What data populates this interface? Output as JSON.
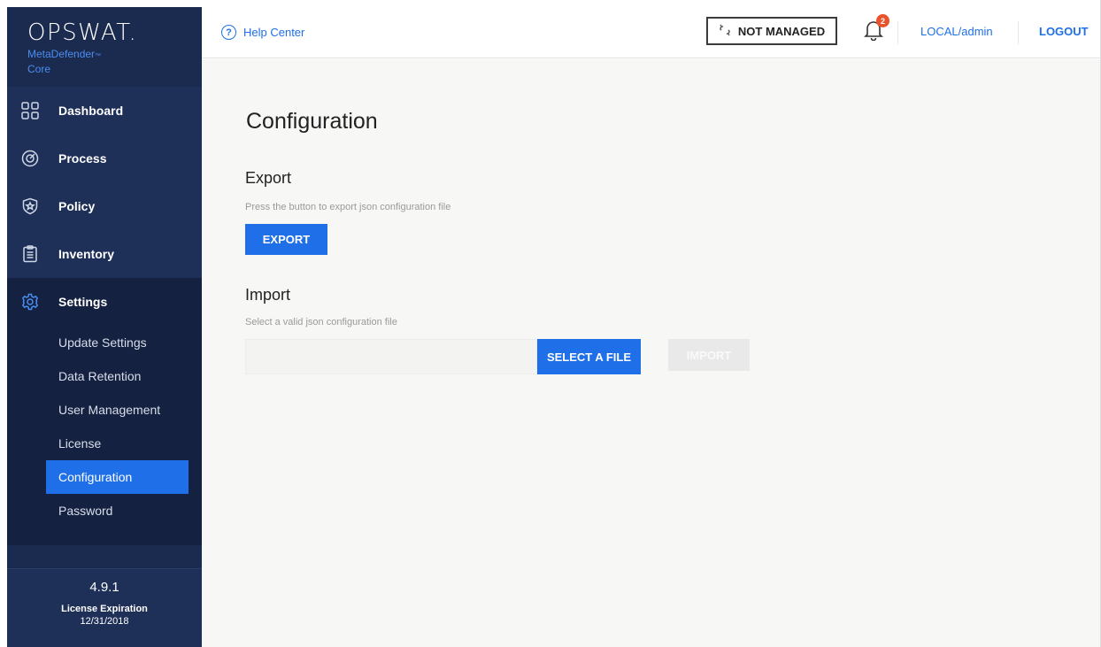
{
  "brand": {
    "logo": "OPSWAT.",
    "product_line1": "MetaDefender",
    "product_line2": "Core"
  },
  "sidebar": {
    "items": [
      {
        "label": "Dashboard",
        "icon": "dashboard-icon"
      },
      {
        "label": "Process",
        "icon": "process-icon"
      },
      {
        "label": "Policy",
        "icon": "policy-icon"
      },
      {
        "label": "Inventory",
        "icon": "inventory-icon"
      },
      {
        "label": "Settings",
        "icon": "gear-icon"
      }
    ],
    "settings_sub": [
      {
        "label": "Update Settings"
      },
      {
        "label": "Data Retention"
      },
      {
        "label": "User Management"
      },
      {
        "label": "License"
      },
      {
        "label": "Configuration"
      },
      {
        "label": "Password"
      }
    ],
    "footer": {
      "version": "4.9.1",
      "license_label": "License Expiration",
      "license_date": "12/31/2018"
    }
  },
  "header": {
    "help": "Help Center",
    "managed": "NOT MANAGED",
    "notifications_count": "2",
    "user": "LOCAL/admin",
    "logout": "LOGOUT"
  },
  "main": {
    "title": "Configuration",
    "export": {
      "heading": "Export",
      "hint": "Press the button to export json configuration file",
      "button": "EXPORT"
    },
    "import": {
      "heading": "Import",
      "hint": "Select a valid json configuration file",
      "select_button": "SELECT A FILE",
      "import_button": "IMPORT"
    }
  },
  "colors": {
    "accent": "#1f6fe8",
    "sidebar": "#1b2a4f",
    "badge": "#e8532b"
  }
}
